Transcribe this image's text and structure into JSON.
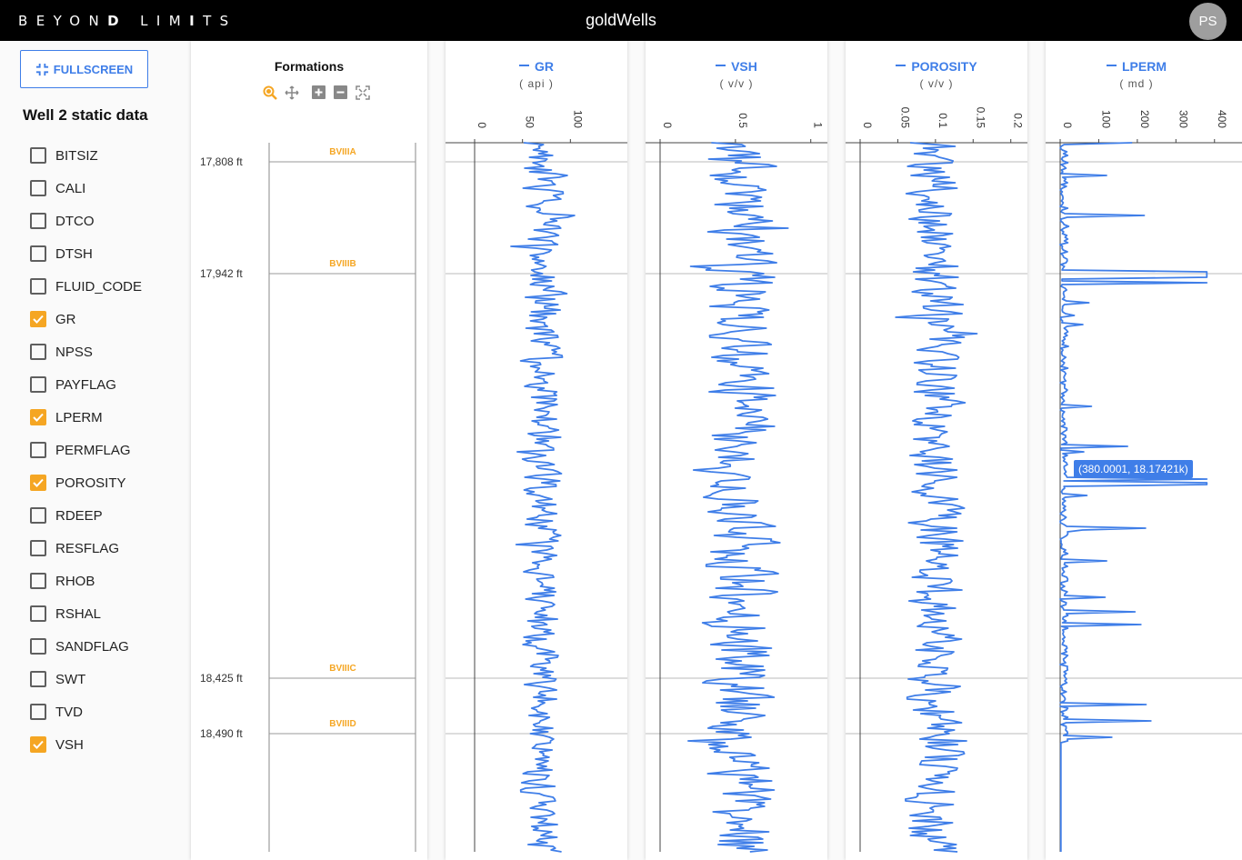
{
  "header": {
    "brand_light1": "BEYON",
    "brand_bold1": "D",
    "brand_light2": " LIM",
    "brand_bold2": "I",
    "brand_light3": "TS",
    "title": "goldWells",
    "avatar": "PS"
  },
  "sidebar": {
    "fullscreen_label": "FULLSCREEN",
    "well_title": "Well 2 static data",
    "curves": [
      {
        "label": "BITSIZ",
        "checked": false
      },
      {
        "label": "CALI",
        "checked": false
      },
      {
        "label": "DTCO",
        "checked": false
      },
      {
        "label": "DTSH",
        "checked": false
      },
      {
        "label": "FLUID_CODE",
        "checked": false
      },
      {
        "label": "GR",
        "checked": true
      },
      {
        "label": "NPSS",
        "checked": false
      },
      {
        "label": "PAYFLAG",
        "checked": false
      },
      {
        "label": "LPERM",
        "checked": true
      },
      {
        "label": "PERMFLAG",
        "checked": false
      },
      {
        "label": "POROSITY",
        "checked": true
      },
      {
        "label": "RDEEP",
        "checked": false
      },
      {
        "label": "RESFLAG",
        "checked": false
      },
      {
        "label": "RHOB",
        "checked": false
      },
      {
        "label": "RSHAL",
        "checked": false
      },
      {
        "label": "SANDFLAG",
        "checked": false
      },
      {
        "label": "SWT",
        "checked": false
      },
      {
        "label": "TVD",
        "checked": false
      },
      {
        "label": "VSH",
        "checked": true
      }
    ]
  },
  "formations_track": {
    "title": "Formations",
    "tools": [
      "zoom-icon",
      "pan-icon",
      "zoom-in-icon",
      "zoom-out-icon",
      "reset-zoom-icon"
    ],
    "tops": [
      {
        "name": "BVIIIA",
        "depth": "17,808 ft"
      },
      {
        "name": "BVIIIB",
        "depth": "17,942 ft"
      },
      {
        "name": "BVIIIC",
        "depth": "18,425 ft"
      },
      {
        "name": "BVIIID",
        "depth": "18,490 ft"
      }
    ]
  },
  "tracks": [
    {
      "name": "GR",
      "unit": "( api )",
      "ticks": [
        "0",
        "50",
        "100"
      ],
      "color": "#3f7ee8"
    },
    {
      "name": "VSH",
      "unit": "( v/v )",
      "ticks": [
        "0",
        "0.5",
        "1"
      ],
      "color": "#3f7ee8"
    },
    {
      "name": "POROSITY",
      "unit": "( v/v )",
      "ticks": [
        "0",
        "0.05",
        "0.1",
        "0.15",
        "0.2"
      ],
      "color": "#3f7ee8"
    },
    {
      "name": "LPERM",
      "unit": "( md )",
      "ticks": [
        "0",
        "100",
        "200",
        "300",
        "400"
      ],
      "color": "#3f7ee8"
    }
  ],
  "tooltip": {
    "text": "(380.0001, 18.17421k)"
  },
  "colors": {
    "accent": "#3f7ee8",
    "formation": "#f5a623",
    "topbar": "#000000"
  }
}
